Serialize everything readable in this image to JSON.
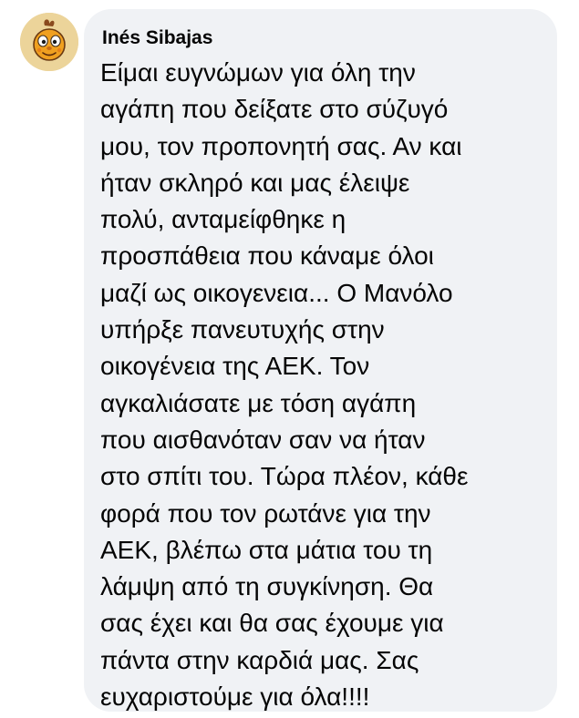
{
  "comment": {
    "author": "Inés Sibajas",
    "text_lines": [
      "Είμαι ευγνώμων για όλη την",
      "αγάπη που δείξατε στο σύζυγό",
      "μου, τον προπονητή σας. Αν και",
      "ήταν σκληρό και μας έλειψε",
      "πολύ, ανταμείφθηκε η",
      "προσπάθεια που κάναμε όλοι",
      "μαζί ως οικογενεια... Ο Μανόλο",
      "υπήρξε πανευτυχής στην",
      "οικογένεια της ΑΕΚ. Τον",
      "αγκαλιάσατε με τόση αγάπη",
      "που αισθανόταν σαν να ήταν",
      "στο σπίτι του. Τώρα πλέον, κάθε",
      "φορά που τον ρωτάνε για την",
      "ΑΕΚ, βλέπω στα μάτια του τη",
      "λάμψη από τη συγκίνηση. Θα",
      "σας έχει και θα σας έχουμε για",
      "πάντα στην καρδιά μας. Σας",
      "ευχαριστούμε για όλα!!!!"
    ]
  },
  "avatar": {
    "icon": "cartoon-bee-avatar-icon"
  },
  "colors": {
    "bubble_background": "#f0f2f5",
    "text": "#050505",
    "avatar_background": "#ecd49a"
  }
}
